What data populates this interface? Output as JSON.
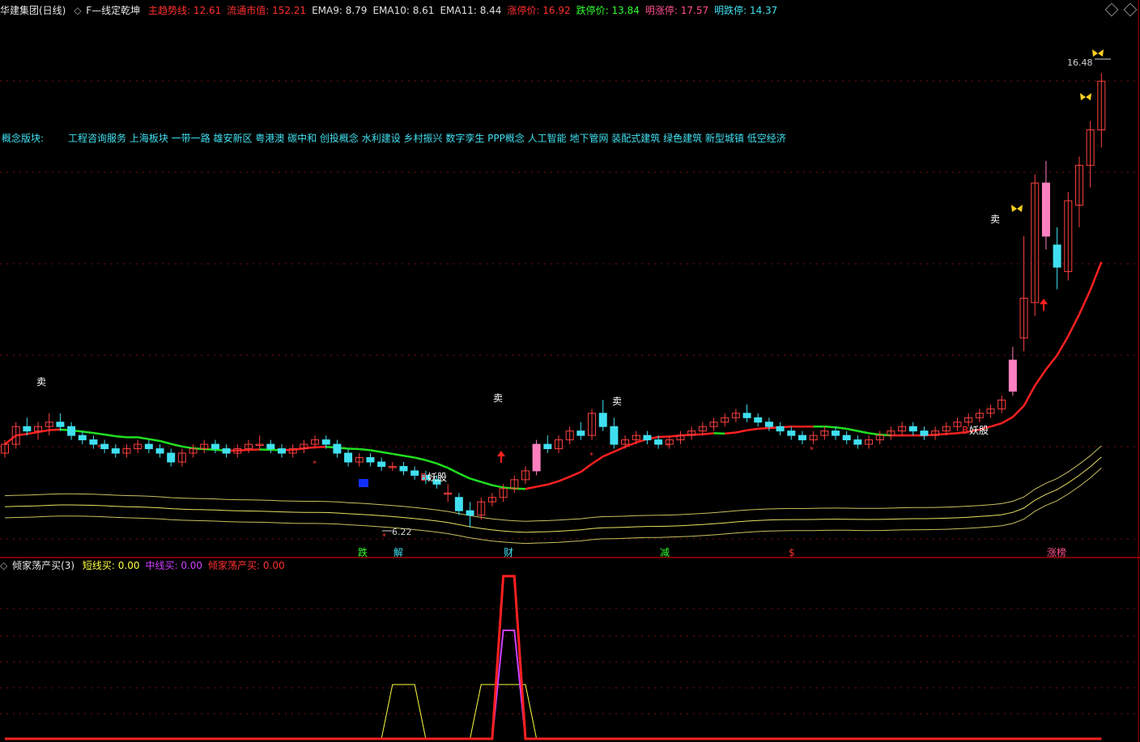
{
  "header": {
    "title": "华建集团(日线)",
    "indicator_name": "F—线定乾坤",
    "items": [
      {
        "label": "主趋势线:",
        "value": "12.61",
        "color": "#ff3030"
      },
      {
        "label": "流通市值:",
        "value": "152.21",
        "color": "#ff3030"
      },
      {
        "label": "EMA9:",
        "value": "8.79",
        "color": "#e0e0e0"
      },
      {
        "label": "EMA10:",
        "value": "8.61",
        "color": "#e0e0e0"
      },
      {
        "label": "EMA11:",
        "value": "8.44",
        "color": "#e0e0e0"
      },
      {
        "label": "涨停价:",
        "value": "16.92",
        "color": "#ff3030"
      },
      {
        "label": "跌停价:",
        "value": "13.84",
        "color": "#30ff30"
      },
      {
        "label": "明涨停:",
        "value": "17.57",
        "color": "#ff5090"
      },
      {
        "label": "明跌停:",
        "value": "14.37",
        "color": "#40e0f0"
      }
    ]
  },
  "concept": {
    "label": "概念版块:",
    "text": "工程咨询服务 上海板块 一带一路 雄安新区 粤港澳 碳中和 创投概念 水利建设 乡村振兴 数字孪生 PPP概念 人工智能 地下管网 装配式建筑 绿色建筑 新型城镇 低空经济"
  },
  "annotations": {
    "sell": "卖",
    "demon": "妖股",
    "b": "B",
    "high": "16.48",
    "low": "6.22",
    "star": "*"
  },
  "bottom_markers": [
    {
      "text": "跌",
      "color": "#30ff30"
    },
    {
      "text": "解",
      "color": "#40e0f0"
    },
    {
      "text": "财",
      "color": "#40e0f0"
    },
    {
      "text": "减",
      "color": "#30ff30"
    },
    {
      "text": "$",
      "color": "#ff3030"
    },
    {
      "text": "涨榜",
      "color": "#ff5090"
    }
  ],
  "sub_header": {
    "title": "倾家荡产买(3)",
    "items": [
      {
        "label": "短线买:",
        "value": "0.00",
        "color": "#ffff40"
      },
      {
        "label": "中线买:",
        "value": "0.00",
        "color": "#d040ff"
      },
      {
        "label": "倾家荡产买:",
        "value": "0.00",
        "color": "#ff3030"
      }
    ]
  },
  "chart_data": [
    {
      "type": "candlestick",
      "title": "华建集团(日线)",
      "price_high_label": 16.48,
      "price_low_label": 6.22,
      "ohlc": [
        [
          7.9,
          8.2,
          7.8,
          8.1
        ],
        [
          8.1,
          8.6,
          8.0,
          8.5
        ],
        [
          8.5,
          8.7,
          8.3,
          8.4
        ],
        [
          8.4,
          8.6,
          8.2,
          8.5
        ],
        [
          8.5,
          8.8,
          8.3,
          8.6
        ],
        [
          8.6,
          8.8,
          8.4,
          8.5
        ],
        [
          8.5,
          8.6,
          8.2,
          8.3
        ],
        [
          8.3,
          8.4,
          8.1,
          8.2
        ],
        [
          8.2,
          8.3,
          8.0,
          8.1
        ],
        [
          8.1,
          8.2,
          7.9,
          8.0
        ],
        [
          8.0,
          8.1,
          7.8,
          7.9
        ],
        [
          7.9,
          8.1,
          7.8,
          8.0
        ],
        [
          8.0,
          8.2,
          7.9,
          8.1
        ],
        [
          8.1,
          8.2,
          7.9,
          8.0
        ],
        [
          8.0,
          8.1,
          7.8,
          7.9
        ],
        [
          7.9,
          8.0,
          7.6,
          7.7
        ],
        [
          7.7,
          8.0,
          7.6,
          7.9
        ],
        [
          7.9,
          8.1,
          7.8,
          8.0
        ],
        [
          8.0,
          8.2,
          7.9,
          8.1
        ],
        [
          8.1,
          8.2,
          7.9,
          8.0
        ],
        [
          8.0,
          8.1,
          7.8,
          7.9
        ],
        [
          7.9,
          8.1,
          7.8,
          8.0
        ],
        [
          8.0,
          8.2,
          7.9,
          8.1
        ],
        [
          8.1,
          8.3,
          8.0,
          8.1
        ],
        [
          8.1,
          8.2,
          7.9,
          8.0
        ],
        [
          8.0,
          8.1,
          7.8,
          7.9
        ],
        [
          7.9,
          8.1,
          7.8,
          8.0
        ],
        [
          8.0,
          8.2,
          7.9,
          8.1
        ],
        [
          8.1,
          8.3,
          8.0,
          8.2
        ],
        [
          8.2,
          8.3,
          8.0,
          8.1
        ],
        [
          8.1,
          8.2,
          7.8,
          7.9
        ],
        [
          7.9,
          8.0,
          7.6,
          7.7
        ],
        [
          7.7,
          7.9,
          7.6,
          7.8
        ],
        [
          7.8,
          7.9,
          7.6,
          7.7
        ],
        [
          7.7,
          7.8,
          7.5,
          7.6
        ],
        [
          7.6,
          7.7,
          7.5,
          7.6
        ],
        [
          7.6,
          7.7,
          7.4,
          7.5
        ],
        [
          7.5,
          7.6,
          7.3,
          7.4
        ],
        [
          7.4,
          7.5,
          7.2,
          7.3
        ],
        [
          7.3,
          7.4,
          7.1,
          7.2
        ],
        [
          7.0,
          7.2,
          6.8,
          7.0
        ],
        [
          6.9,
          7.0,
          6.5,
          6.6
        ],
        [
          6.6,
          6.8,
          6.22,
          6.5
        ],
        [
          6.5,
          6.9,
          6.4,
          6.8
        ],
        [
          6.8,
          7.0,
          6.7,
          6.9
        ],
        [
          6.9,
          7.2,
          6.8,
          7.1
        ],
        [
          7.1,
          7.4,
          7.0,
          7.3
        ],
        [
          7.3,
          7.6,
          7.2,
          7.5
        ],
        [
          7.5,
          8.2,
          7.4,
          8.1
        ],
        [
          8.1,
          8.3,
          7.9,
          8.0
        ],
        [
          8.0,
          8.3,
          7.9,
          8.2
        ],
        [
          8.2,
          8.5,
          8.1,
          8.4
        ],
        [
          8.4,
          8.6,
          8.2,
          8.3
        ],
        [
          8.3,
          8.9,
          8.2,
          8.8
        ],
        [
          8.8,
          9.1,
          8.4,
          8.5
        ],
        [
          8.5,
          8.7,
          8.0,
          8.1
        ],
        [
          8.1,
          8.3,
          8.0,
          8.2
        ],
        [
          8.2,
          8.4,
          8.1,
          8.3
        ],
        [
          8.3,
          8.4,
          8.1,
          8.2
        ],
        [
          8.2,
          8.3,
          8.0,
          8.1
        ],
        [
          8.1,
          8.3,
          8.0,
          8.2
        ],
        [
          8.2,
          8.4,
          8.1,
          8.3
        ],
        [
          8.3,
          8.5,
          8.2,
          8.4
        ],
        [
          8.4,
          8.6,
          8.3,
          8.5
        ],
        [
          8.5,
          8.7,
          8.4,
          8.6
        ],
        [
          8.6,
          8.8,
          8.5,
          8.7
        ],
        [
          8.7,
          8.9,
          8.6,
          8.8
        ],
        [
          8.8,
          9.0,
          8.6,
          8.7
        ],
        [
          8.7,
          8.8,
          8.5,
          8.6
        ],
        [
          8.6,
          8.7,
          8.4,
          8.5
        ],
        [
          8.5,
          8.6,
          8.3,
          8.4
        ],
        [
          8.4,
          8.5,
          8.2,
          8.3
        ],
        [
          8.3,
          8.4,
          8.1,
          8.2
        ],
        [
          8.2,
          8.4,
          8.1,
          8.3
        ],
        [
          8.3,
          8.5,
          8.2,
          8.4
        ],
        [
          8.4,
          8.5,
          8.2,
          8.3
        ],
        [
          8.3,
          8.4,
          8.1,
          8.2
        ],
        [
          8.2,
          8.3,
          8.0,
          8.1
        ],
        [
          8.1,
          8.3,
          8.0,
          8.2
        ],
        [
          8.2,
          8.4,
          8.1,
          8.3
        ],
        [
          8.3,
          8.5,
          8.2,
          8.4
        ],
        [
          8.4,
          8.6,
          8.3,
          8.5
        ],
        [
          8.5,
          8.6,
          8.3,
          8.4
        ],
        [
          8.4,
          8.5,
          8.2,
          8.3
        ],
        [
          8.3,
          8.5,
          8.2,
          8.4
        ],
        [
          8.4,
          8.6,
          8.3,
          8.5
        ],
        [
          8.5,
          8.7,
          8.4,
          8.6
        ],
        [
          8.6,
          8.8,
          8.5,
          8.7
        ],
        [
          8.7,
          8.9,
          8.6,
          8.8
        ],
        [
          8.8,
          9.0,
          8.7,
          8.9
        ],
        [
          8.9,
          9.2,
          8.8,
          9.1
        ],
        [
          9.3,
          10.3,
          9.2,
          10.0
        ],
        [
          10.5,
          12.8,
          10.2,
          11.4
        ],
        [
          11.3,
          14.2,
          11.0,
          14.0
        ],
        [
          14.0,
          14.5,
          12.5,
          12.8
        ],
        [
          12.6,
          13.0,
          11.6,
          12.1
        ],
        [
          12.0,
          13.8,
          11.8,
          13.6
        ],
        [
          13.5,
          14.6,
          13.0,
          14.4
        ],
        [
          14.4,
          15.4,
          13.9,
          15.2
        ],
        [
          15.2,
          16.48,
          14.8,
          16.3
        ]
      ]
    },
    {
      "type": "line",
      "title": "倾家荡产买(3)",
      "series": [
        {
          "name": "短线买",
          "color": "#ffff40",
          "values": [
            0,
            0,
            0,
            0,
            0,
            0,
            0,
            0,
            0,
            0,
            0,
            0,
            0,
            0,
            0,
            0,
            0,
            0,
            0,
            0,
            0,
            0,
            0,
            0,
            0,
            0,
            0,
            0,
            0,
            0,
            0,
            0,
            0,
            0,
            0,
            1,
            1,
            1,
            0,
            0,
            0,
            0,
            0,
            1,
            1,
            1,
            1,
            1,
            0,
            0,
            0,
            0,
            0,
            0,
            0,
            0,
            0,
            0,
            0,
            0,
            0,
            0,
            0,
            0,
            0,
            0,
            0,
            0,
            0,
            0,
            0,
            0,
            0,
            0,
            0,
            0,
            0,
            0,
            0,
            0,
            0,
            0,
            0,
            0,
            0,
            0,
            0,
            0,
            0,
            0,
            0,
            0,
            0,
            0,
            0,
            0,
            0,
            0,
            0,
            0
          ]
        },
        {
          "name": "中线买",
          "color": "#d040ff",
          "values": [
            0,
            0,
            0,
            0,
            0,
            0,
            0,
            0,
            0,
            0,
            0,
            0,
            0,
            0,
            0,
            0,
            0,
            0,
            0,
            0,
            0,
            0,
            0,
            0,
            0,
            0,
            0,
            0,
            0,
            0,
            0,
            0,
            0,
            0,
            0,
            0,
            0,
            0,
            0,
            0,
            0,
            0,
            0,
            0,
            0,
            2,
            2,
            0,
            0,
            0,
            0,
            0,
            0,
            0,
            0,
            0,
            0,
            0,
            0,
            0,
            0,
            0,
            0,
            0,
            0,
            0,
            0,
            0,
            0,
            0,
            0,
            0,
            0,
            0,
            0,
            0,
            0,
            0,
            0,
            0,
            0,
            0,
            0,
            0,
            0,
            0,
            0,
            0,
            0,
            0,
            0,
            0,
            0,
            0,
            0,
            0,
            0,
            0,
            0,
            0
          ]
        },
        {
          "name": "倾家荡产买",
          "color": "#ff2020",
          "values": [
            0,
            0,
            0,
            0,
            0,
            0,
            0,
            0,
            0,
            0,
            0,
            0,
            0,
            0,
            0,
            0,
            0,
            0,
            0,
            0,
            0,
            0,
            0,
            0,
            0,
            0,
            0,
            0,
            0,
            0,
            0,
            0,
            0,
            0,
            0,
            0,
            0,
            0,
            0,
            0,
            0,
            0,
            0,
            0,
            0,
            3,
            3,
            0,
            0,
            0,
            0,
            0,
            0,
            0,
            0,
            0,
            0,
            0,
            0,
            0,
            0,
            0,
            0,
            0,
            0,
            0,
            0,
            0,
            0,
            0,
            0,
            0,
            0,
            0,
            0,
            0,
            0,
            0,
            0,
            0,
            0,
            0,
            0,
            0,
            0,
            0,
            0,
            0,
            0,
            0,
            0,
            0,
            0,
            0,
            0,
            0,
            0,
            0,
            0,
            0
          ]
        }
      ]
    }
  ]
}
